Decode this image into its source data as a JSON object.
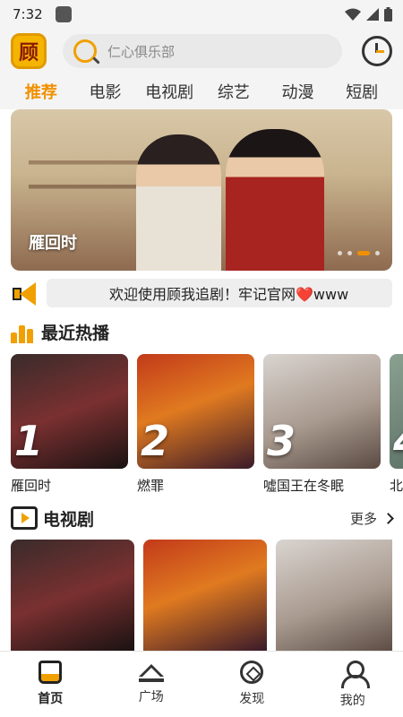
{
  "status_bar": {
    "time": "7:32"
  },
  "header": {
    "logo_text": "顾",
    "search_placeholder": "仁心俱乐部"
  },
  "tabs": [
    "推荐",
    "电影",
    "电视剧",
    "综艺",
    "动漫",
    "短剧"
  ],
  "banner": {
    "title": "雁回时",
    "slides": 4,
    "active_slide": 3
  },
  "marquee": {
    "text": "欢迎使用顾我追剧！牢记官网❤️www"
  },
  "hot_section": {
    "title": "最近热播",
    "items": [
      {
        "rank": "1",
        "name": "雁回时"
      },
      {
        "rank": "2",
        "name": "燃罪"
      },
      {
        "rank": "3",
        "name": "噓国王在冬眠"
      },
      {
        "rank": "4",
        "name": "北上"
      }
    ]
  },
  "tv_section": {
    "title": "电视剧",
    "more_label": "更多"
  },
  "bottom_nav": [
    {
      "label": "首页",
      "icon": "home-icon"
    },
    {
      "label": "广场",
      "icon": "crown-icon"
    },
    {
      "label": "发现",
      "icon": "compass-icon"
    },
    {
      "label": "我的",
      "icon": "user-icon"
    }
  ],
  "colors": {
    "accent": "#f09000"
  }
}
